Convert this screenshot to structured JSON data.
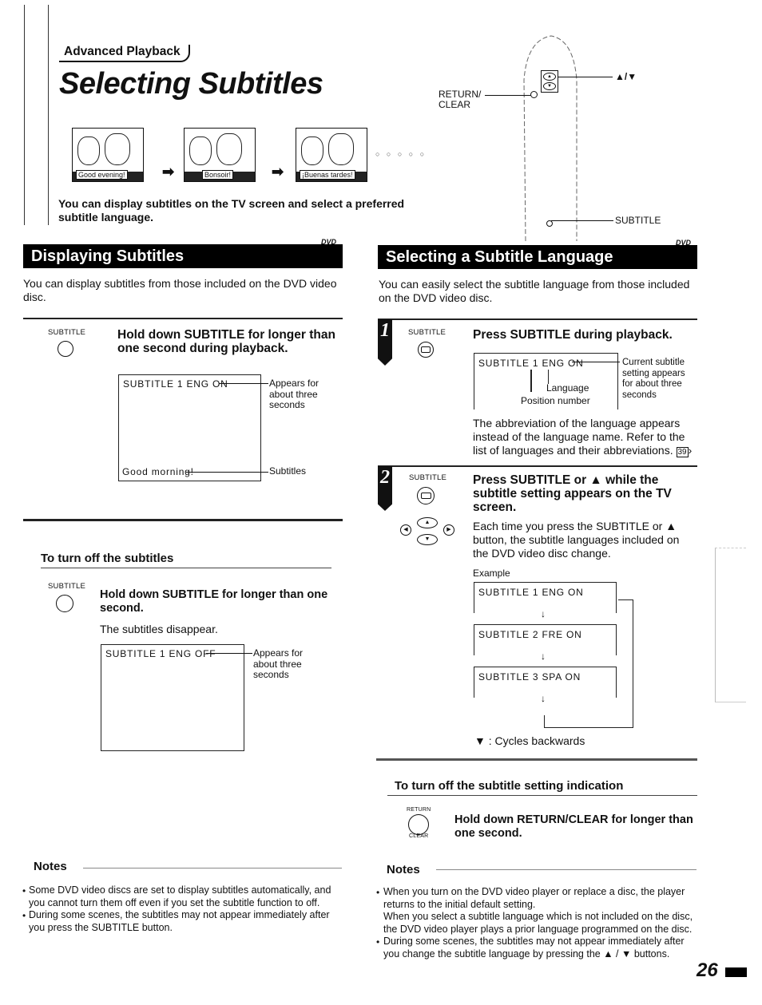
{
  "header": {
    "breadcrumb": "Advanced Playback",
    "title": "Selecting Subtitles",
    "intro": "You can display subtitles on the TV screen and select a preferred subtitle language."
  },
  "illustration": {
    "frames": [
      "Good evening!",
      "Bonsoir!",
      "¡Buenas tardes!"
    ],
    "arrow_glyph": "➡",
    "dots": "○ ○ ○ ○ ○"
  },
  "remote": {
    "return_clear_label": "RETURN/\nCLEAR",
    "return_label_line1": "RETURN/",
    "return_label_line2": "CLEAR",
    "updown_label": "▲/▼",
    "subtitle_label": "SUBTITLE"
  },
  "left_section": {
    "title": "Displaying Subtitles",
    "badge": "DVD",
    "description": "You can display subtitles from those included on the DVD video disc.",
    "step": {
      "button_label": "SUBTITLE",
      "instruction": "Hold down SUBTITLE for longer than one second during playback.",
      "screen_top": "SUBTITLE  1  ENG  ON",
      "screen_bottom": "Good  morning!",
      "callout_top": "Appears for about three seconds",
      "callout_bottom": "Subtitles"
    },
    "turn_off": {
      "heading": "To turn off the subtitles",
      "button_label": "SUBTITLE",
      "instruction": "Hold down SUBTITLE for longer than one second.",
      "result": "The subtitles disappear.",
      "screen_top": "SUBTITLE  1  ENG  OFF",
      "callout": "Appears for about three seconds"
    },
    "notes": {
      "heading": "Notes",
      "items": [
        "Some DVD video discs are set to display subtitles automatically, and you cannot turn them off even if you set the subtitle function to off.",
        "During some scenes, the subtitles may not appear immediately after you press the SUBTITLE button."
      ]
    }
  },
  "right_section": {
    "title": "Selecting a Subtitle Language",
    "badge": "DVD",
    "description": "You can easily select the subtitle language from those included on the DVD video disc.",
    "step1": {
      "number": "1",
      "button_label": "SUBTITLE",
      "instruction": "Press SUBTITLE during playback.",
      "screen_text": "SUBTITLE  1  ENG  ON",
      "label_language": "Language",
      "label_position": "Position number",
      "callout": "Current subtitle setting appears for about three seconds",
      "body": "The abbreviation of the language appears instead of the language name. Refer to the list of languages and their abbreviations.",
      "page_ref": "39"
    },
    "step2": {
      "number": "2",
      "button_label": "SUBTITLE",
      "instruction": "Press SUBTITLE or ▲ while the subtitle setting appears on the TV screen.",
      "body": "Each time you press the SUBTITLE or ▲ button, the subtitle languages included on the DVD video disc change.",
      "example_label": "Example",
      "screens": [
        "SUBTITLE  1  ENG  ON",
        "SUBTITLE  2  FRE  ON",
        "SUBTITLE  3  SPA  ON"
      ],
      "cycle_note": "▼ : Cycles backwards"
    },
    "turn_off": {
      "heading": "To turn off the subtitle setting indication",
      "button_top": "RETURN",
      "button_bottom": "CLEAR",
      "instruction": "Hold down RETURN/CLEAR for longer than one second."
    },
    "notes": {
      "heading": "Notes",
      "items": [
        "When you turn on the DVD video player or replace a disc, the player returns to the initial default setting.\nWhen you select a subtitle language which is not included on the disc, the DVD video player plays a prior language programmed on the disc.",
        "During some scenes, the subtitles may not appear immediately after you change the subtitle language by pressing the ▲ / ▼ buttons."
      ]
    }
  },
  "footer": {
    "page_number": "26"
  }
}
